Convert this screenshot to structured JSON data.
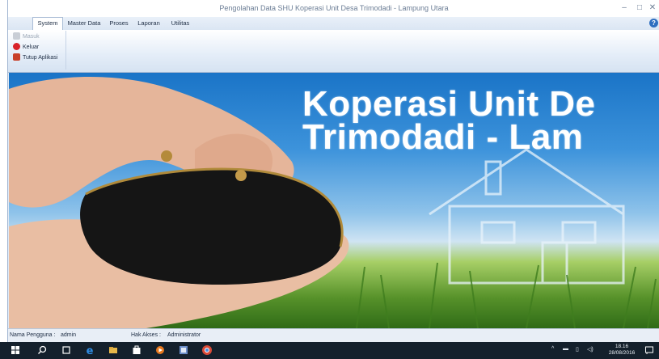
{
  "window": {
    "title": "Pengolahan Data SHU Koperasi Unit Desa Trimodadi - Lampung Utara",
    "controls": {
      "minimize": "–",
      "maximize": "□",
      "close": "✕"
    }
  },
  "menubar": {
    "items": [
      {
        "label": "System",
        "active": true
      },
      {
        "label": "Master Data",
        "active": false
      },
      {
        "label": "Proses",
        "active": false
      },
      {
        "label": "Laporan",
        "active": false
      },
      {
        "label": "Utilitas",
        "active": false
      }
    ],
    "help_icon": "?"
  },
  "ribbon": {
    "items": [
      {
        "label": "Masuk",
        "icon": "login-icon",
        "enabled": false
      },
      {
        "label": "Keluar",
        "icon": "logout-icon",
        "enabled": true
      },
      {
        "label": "Tutup Aplikasi",
        "icon": "close-app-icon",
        "enabled": true
      }
    ]
  },
  "banner": {
    "line1": "Koperasi Unit De",
    "line2": "Trimodadi - Lam"
  },
  "statusbar": {
    "user_label": "Nama Pengguna :",
    "user_value": "admin",
    "access_label": "Hak Akses :",
    "access_value": "Administrator"
  },
  "taskbar": {
    "time": "18.16",
    "date": "28/08/2016",
    "icons": [
      "start-icon",
      "search-icon",
      "task-view-icon",
      "edge-icon",
      "explorer-icon",
      "store-icon",
      "media-icon",
      "app-icon",
      "chrome-icon"
    ]
  },
  "colors": {
    "accent": "#2f6fc0",
    "taskbar": "#14202c",
    "banner_text": "#ffffff"
  }
}
